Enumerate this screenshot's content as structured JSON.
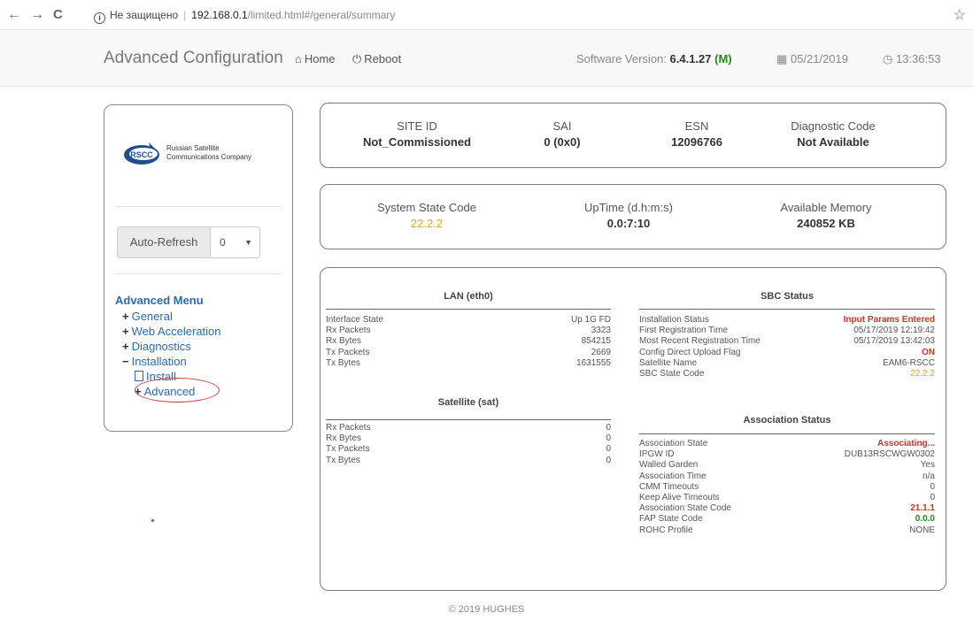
{
  "browser": {
    "back": "←",
    "forward": "→",
    "reload": "C",
    "info": "i",
    "security": "Не защищено",
    "separator": "|",
    "host": "192.168.0.1",
    "path": "/limited.html#/general/summary",
    "star": "☆"
  },
  "navbar": {
    "brand": "Advanced Configuration",
    "home_icon": "home-icon",
    "home": "Home",
    "reboot_icon": "power-icon",
    "reboot": "Reboot",
    "version_label": "Software Version:",
    "version": "6.4.1.27",
    "version_suffix": "(M)",
    "date_icon": "calendar-icon",
    "date": "05/21/2019",
    "time_icon": "clock-icon",
    "time": "13:36:53"
  },
  "sidebar": {
    "logo_line1": "Russian Satellite",
    "logo_line2": "Communications Company",
    "logo_mark": "RSCC",
    "auto_refresh": "Auto-Refresh",
    "refresh_value": "0",
    "menu_title": "Advanced Menu",
    "items": [
      {
        "sign": "+",
        "label": "General"
      },
      {
        "sign": "+",
        "label": "Web Acceleration"
      },
      {
        "sign": "+",
        "label": "Diagnostics"
      },
      {
        "sign": "−",
        "label": "Installation"
      }
    ],
    "install": "Install",
    "advanced": "Advanced",
    "advanced_sign": "+"
  },
  "summary": {
    "site_id_label": "SITE ID",
    "site_id": "Not_Commissioned",
    "sai_label": "SAI",
    "sai": "0 (0x0)",
    "esn_label": "ESN",
    "esn": "12096766",
    "diag_label": "Diagnostic Code",
    "diag": "Not Available"
  },
  "system": {
    "state_label": "System State Code",
    "state": "22.2.2",
    "uptime_label": "UpTime (d.h:m:s)",
    "uptime": "0.0:7:10",
    "mem_label": "Available Memory",
    "mem": "240852 KB"
  },
  "lan": {
    "title": "LAN (eth0)",
    "rows": [
      {
        "k": "Interface State",
        "v": "Up 1G FD"
      },
      {
        "k": "Rx Packets",
        "v": "3323"
      },
      {
        "k": "Rx Bytes",
        "v": "854215"
      },
      {
        "k": "Tx Packets",
        "v": "2669"
      },
      {
        "k": "Tx Bytes",
        "v": "1631555"
      }
    ]
  },
  "satellite": {
    "title": "Satellite (sat)",
    "rows": [
      {
        "k": "Rx Packets",
        "v": "0"
      },
      {
        "k": "Rx Bytes",
        "v": "0"
      },
      {
        "k": "Tx Packets",
        "v": "0"
      },
      {
        "k": "Tx Bytes",
        "v": "0"
      }
    ]
  },
  "sbc": {
    "title": "SBC Status",
    "rows": [
      {
        "k": "Installation Status",
        "v": "Input Params Entered",
        "style": "red"
      },
      {
        "k": "First Registration Time",
        "v": "05/17/2019 12:19:42",
        "style": ""
      },
      {
        "k": "Most Recent Registration Time",
        "v": "05/17/2019 13:42:03",
        "style": ""
      },
      {
        "k": "Config Direct Upload Flag",
        "v": "ON",
        "style": "red"
      },
      {
        "k": "Satellite Name",
        "v": "EAM6-RSCC",
        "style": ""
      },
      {
        "k": "SBC State Code",
        "v": "22.2.2",
        "style": "orange"
      }
    ]
  },
  "association": {
    "title": "Association Status",
    "rows": [
      {
        "k": "Association State",
        "v": "Associating...",
        "style": "red"
      },
      {
        "k": "IPGW ID",
        "v": "DUB13RSCWGW0302",
        "style": ""
      },
      {
        "k": "Walled Garden",
        "v": "Yes",
        "style": ""
      },
      {
        "k": "Association Time",
        "v": "n/a",
        "style": ""
      },
      {
        "k": "CMM Timeouts",
        "v": "0",
        "style": ""
      },
      {
        "k": "Keep Alive Timeouts",
        "v": "0",
        "style": ""
      },
      {
        "k": "Association State Code",
        "v": "21.1.1",
        "style": "red"
      },
      {
        "k": "FAP State Code",
        "v": "0.0.0",
        "style": "green"
      },
      {
        "k": "ROHC Profile",
        "v": "NONE",
        "style": ""
      }
    ]
  },
  "footer": "© 2019 HUGHES"
}
